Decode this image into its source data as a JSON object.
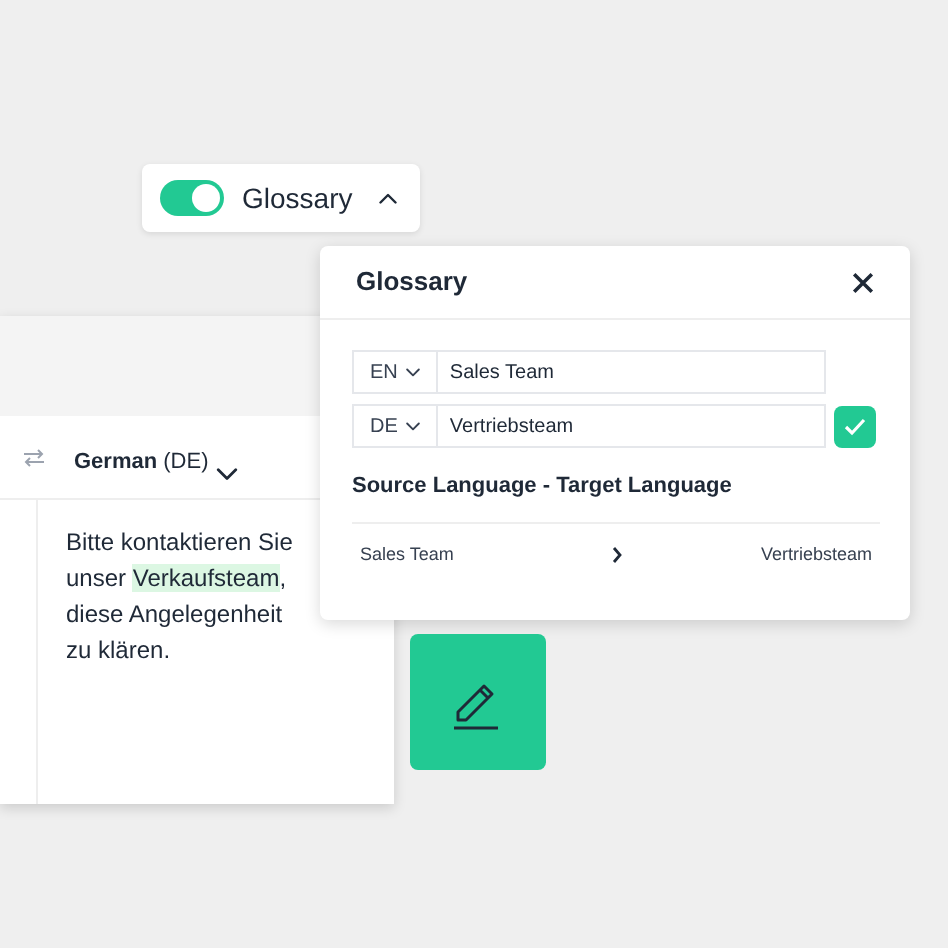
{
  "glossary_toggle": {
    "label": "Glossary",
    "on": true,
    "expanded": true
  },
  "editor": {
    "target_language": "**German** (DE)",
    "text_before": "Bitte kontaktieren Sie unser ",
    "highlight": "Verkaufsteam",
    "text_after": ", diese Angelegenheit zu klären."
  },
  "glossary_panel": {
    "title": "Glossary",
    "source": {
      "lang": "EN",
      "value": "Sales Team"
    },
    "target": {
      "lang": "DE",
      "value": "Vertriebsteam"
    },
    "list_heading": "Source Language - Target Language",
    "entries": [
      {
        "source": "Sales Team",
        "target": "Vertriebsteam"
      }
    ]
  }
}
